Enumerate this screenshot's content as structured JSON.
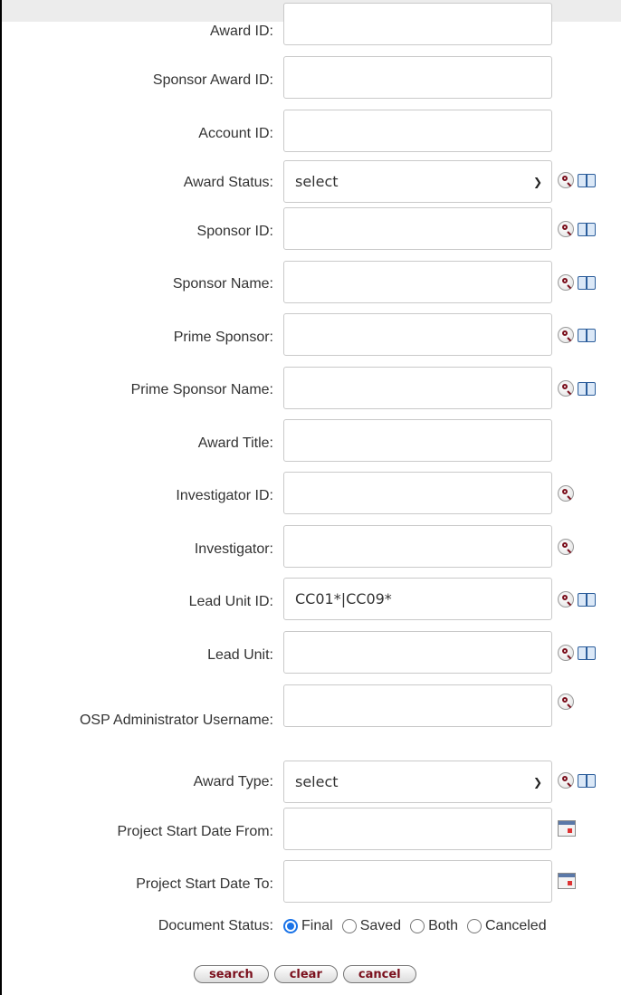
{
  "fields": [
    {
      "label": "Award ID:",
      "value": ""
    },
    {
      "label": "Sponsor Award ID:",
      "value": ""
    },
    {
      "label": "Account ID:",
      "value": ""
    },
    {
      "label": "Award Status:",
      "value": "select"
    },
    {
      "label": "Sponsor ID:",
      "value": ""
    },
    {
      "label": "Sponsor Name:",
      "value": ""
    },
    {
      "label": "Prime Sponsor:",
      "value": ""
    },
    {
      "label": "Prime Sponsor Name:",
      "value": ""
    },
    {
      "label": "Award Title:",
      "value": ""
    },
    {
      "label": "Investigator ID:",
      "value": ""
    },
    {
      "label": "Investigator:",
      "value": ""
    },
    {
      "label": "Lead Unit ID:",
      "value": "CC01*|CC09*"
    },
    {
      "label": "Lead Unit:",
      "value": ""
    },
    {
      "label": "OSP Administrator Username:",
      "value": ""
    },
    {
      "label": "Award Type:",
      "value": "select"
    },
    {
      "label": "Project Start Date From:",
      "value": ""
    },
    {
      "label": "Project Start Date To:",
      "value": ""
    }
  ],
  "document_status": {
    "label": "Document Status:",
    "options": [
      "Final",
      "Saved",
      "Both",
      "Canceled"
    ],
    "selected": "Final"
  },
  "buttons": {
    "search": "search",
    "clear": "clear",
    "cancel": "cancel"
  },
  "icons": {
    "lookup": "magnifier-lookup-icon",
    "inquiry": "book-inquiry-icon",
    "calendar": "calendar-icon"
  },
  "colors": {
    "button_text": "#7a0f1c",
    "radio_selected": "#1a73e8"
  }
}
